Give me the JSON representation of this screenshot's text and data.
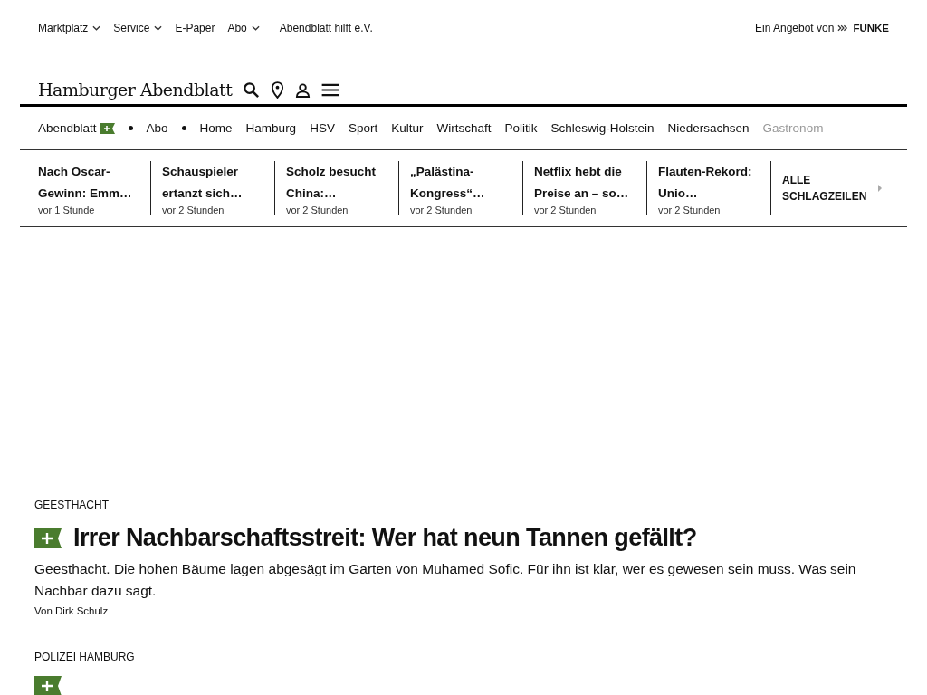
{
  "top_menu": [
    {
      "label": "Marktplatz",
      "dropdown": true
    },
    {
      "label": "Service",
      "dropdown": true
    },
    {
      "label": "E-Paper",
      "dropdown": false
    },
    {
      "label": "Abo",
      "dropdown": true
    },
    {
      "label": "Abendblatt hilft e.V.",
      "dropdown": false
    }
  ],
  "publisher": {
    "prefix": "Ein Angebot von",
    "name": "FUNKE"
  },
  "logo": "Hamburger Abendblatt",
  "nav": [
    {
      "label": "Abendblatt",
      "plus_badge": true,
      "separator_after": true
    },
    {
      "label": "Abo",
      "plus_badge": false,
      "separator_after": true
    },
    {
      "label": "Home",
      "plus_badge": false,
      "separator_after": false
    },
    {
      "label": "Hamburg",
      "plus_badge": false,
      "separator_after": false
    },
    {
      "label": "HSV",
      "plus_badge": false,
      "separator_after": false
    },
    {
      "label": "Sport",
      "plus_badge": false,
      "separator_after": false
    },
    {
      "label": "Kultur",
      "plus_badge": false,
      "separator_after": false
    },
    {
      "label": "Wirtschaft",
      "plus_badge": false,
      "separator_after": false
    },
    {
      "label": "Politik",
      "plus_badge": false,
      "separator_after": false
    },
    {
      "label": "Schleswig-Holstein",
      "plus_badge": false,
      "separator_after": false
    },
    {
      "label": "Niedersachsen",
      "plus_badge": false,
      "separator_after": false
    },
    {
      "label": "Gastronom",
      "plus_badge": false,
      "separator_after": false
    }
  ],
  "headlines": [
    {
      "title": "Nach Oscar-Gewinn: Emm…",
      "time": "vor 1 Stunde"
    },
    {
      "title": "Schauspieler ertanzt sich…",
      "time": "vor 2 Stunden"
    },
    {
      "title": "Scholz besucht China:…",
      "time": "vor 2 Stunden"
    },
    {
      "title": "„Palästina-Kongress“…",
      "time": "vor 2 Stunden"
    },
    {
      "title": "Netflix hebt die Preise an – so…",
      "time": "vor 2 Stunden"
    },
    {
      "title": "Flauten-Rekord: Unio…",
      "time": "vor 2 Stunden"
    }
  ],
  "all_headlines": "ALLE SCHLAGZEILEN",
  "articles": [
    {
      "kicker": "GEESTHACHT",
      "plus": true,
      "title": "Irrer Nachbarschaftsstreit: Wer hat neun Tannen gefällt?",
      "teaser": "Geesthacht. Die hohen Bäume lagen abgesägt im Garten von Muhamed Sofic. Für ihn ist klar, wer es gewesen sein muss. Was sein Nachbar dazu sagt.",
      "author": "Von Dirk Schulz"
    },
    {
      "kicker": "POLIZEI HAMBURG",
      "plus": true
    }
  ]
}
